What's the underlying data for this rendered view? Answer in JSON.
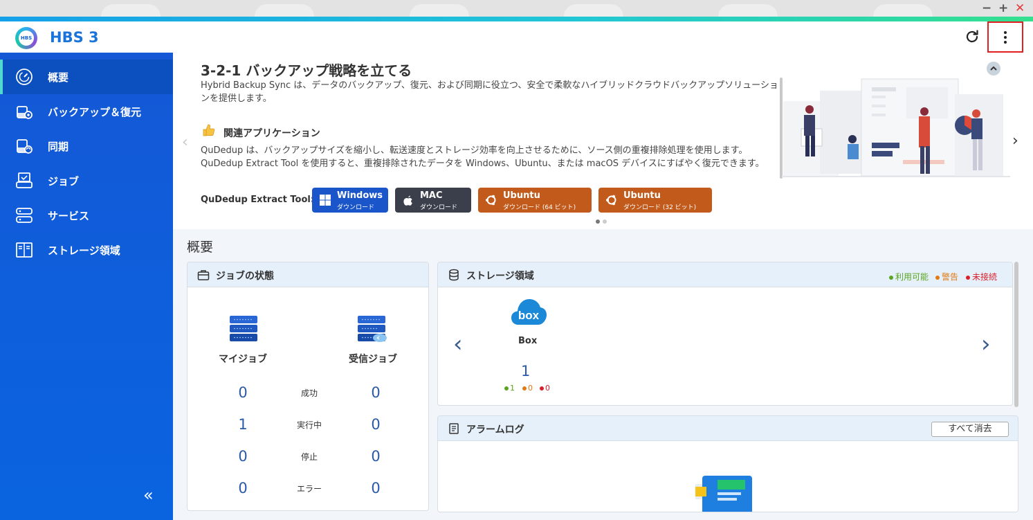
{
  "window": {
    "minimize": "−",
    "maximize": "+",
    "close": "✕"
  },
  "header": {
    "app_logo_text": "HBS",
    "app_title": "HBS 3"
  },
  "sidebar": {
    "items": [
      {
        "label": "概要",
        "icon": "gauge-icon",
        "active": true
      },
      {
        "label": "バックアップ＆復元",
        "icon": "backup-restore-icon"
      },
      {
        "label": "同期",
        "icon": "sync-icon"
      },
      {
        "label": "ジョブ",
        "icon": "job-icon"
      },
      {
        "label": "サービス",
        "icon": "service-icon"
      },
      {
        "label": "ストレージ領域",
        "icon": "storage-space-icon"
      }
    ],
    "collapse": "«"
  },
  "banner": {
    "title": "3-2-1 バックアップ戦略を立てる",
    "description": "Hybrid Backup Sync は、データのバックアップ、復元、および同期に役立つ、安全で柔軟なハイブリッドクラウドバックアップソリューションを提供します。",
    "section_title": "関連アプリケーション",
    "section_text": "QuDedup は、バックアップサイズを縮小し、転送速度とストレージ効率を向上させるために、ソース側の重複排除処理を使用します。 QuDedup Extract Tool を使用すると、重複排除されたデータを Windows、Ubuntu、または macOS デバイスにすばやく復元できます。",
    "tool_label": "QuDedup Extract Tool:",
    "buttons": [
      {
        "title": "Windows",
        "sub": "ダウンロード"
      },
      {
        "title": "MAC",
        "sub": "ダウンロード"
      },
      {
        "title": "Ubuntu",
        "sub": "ダウンロード (64 ビット)"
      },
      {
        "title": "Ubuntu",
        "sub": "ダウンロード (32 ビット)"
      }
    ],
    "prev": "‹",
    "next": "›"
  },
  "overview": {
    "title": "概要",
    "job_status": {
      "title": "ジョブの状態",
      "my_jobs": "マイジョブ",
      "incoming_jobs": "受信ジョブ",
      "rows": [
        {
          "label": "成功",
          "mine": "0",
          "incoming": "0"
        },
        {
          "label": "実行中",
          "mine": "1",
          "incoming": "0"
        },
        {
          "label": "停止",
          "mine": "0",
          "incoming": "0"
        },
        {
          "label": "エラー",
          "mine": "0",
          "incoming": "0"
        }
      ]
    },
    "storage": {
      "title": "ストレージ領域",
      "legend": [
        {
          "label": "利用可能",
          "color": "#5aa51e"
        },
        {
          "label": "警告",
          "color": "#e07a12"
        },
        {
          "label": "未接続",
          "color": "#d8202a"
        }
      ],
      "item": {
        "logo_text": "box",
        "name": "Box",
        "count": "1",
        "available": "1",
        "warning": "0",
        "disconnected": "0"
      },
      "prev": "‹",
      "next": "›"
    },
    "alarm_log": {
      "title": "アラームログ",
      "clear_all": "すべて消去"
    }
  }
}
